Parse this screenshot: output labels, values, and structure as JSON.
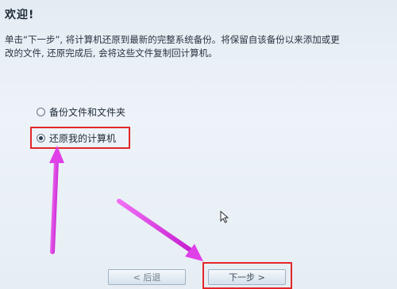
{
  "header": {
    "title": "欢迎!"
  },
  "description": {
    "line1": "单击“下一步”, 将计算机还原到最新的完整系统备份。将保留自该备份以来添加或更",
    "line2": "改的文件, 还原完成后, 会将这些文件复制回计算机。"
  },
  "options": {
    "backup": {
      "label": "备份文件和文件夹",
      "selected": false
    },
    "restore": {
      "label": "还原我的计算机",
      "selected": true
    }
  },
  "buttons": {
    "back_label": "< 后退",
    "next_label": "下一步 >"
  },
  "colors": {
    "highlight": "#e3262a",
    "arrow": "#e040e8"
  }
}
